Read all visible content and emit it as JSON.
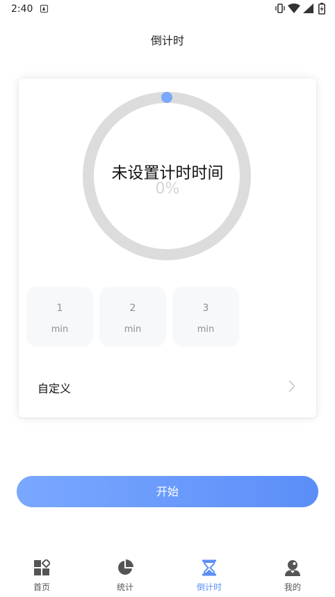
{
  "status_bar": {
    "time": "2:40",
    "icons": [
      "notification-a-icon",
      "vibrate-icon",
      "wifi-icon",
      "signal-icon",
      "battery-icon"
    ]
  },
  "header": {
    "title": "倒计时"
  },
  "timer": {
    "status_text": "未设置计时时间",
    "percent_text": "0%",
    "progress": 0,
    "colors": {
      "ring_track": "#dcdcdc",
      "knob": "#7aa8ff"
    }
  },
  "presets": [
    {
      "value": "1",
      "unit": "min"
    },
    {
      "value": "2",
      "unit": "min"
    },
    {
      "value": "3",
      "unit": "min"
    }
  ],
  "custom": {
    "label": "自定义"
  },
  "start_button": {
    "label": "开始"
  },
  "tabs": [
    {
      "label": "首页",
      "icon": "home-grid-icon",
      "active": false
    },
    {
      "label": "统计",
      "icon": "pie-chart-icon",
      "active": false
    },
    {
      "label": "倒计时",
      "icon": "hourglass-icon",
      "active": true
    },
    {
      "label": "我的",
      "icon": "user-icon",
      "active": false
    }
  ],
  "colors": {
    "accent": "#5b8ef8",
    "tab_inactive": "#555555"
  }
}
